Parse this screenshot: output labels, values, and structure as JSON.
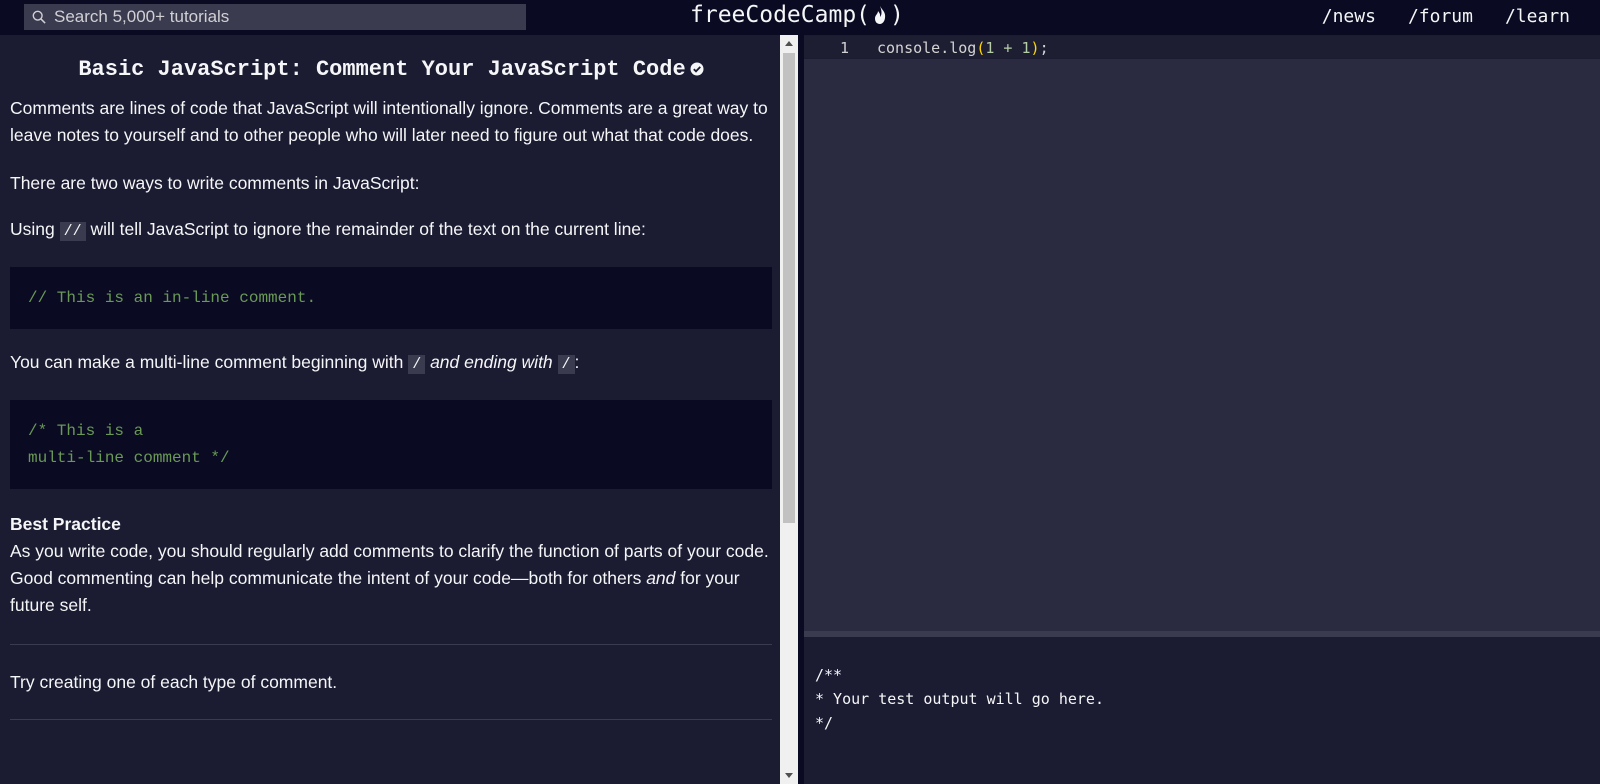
{
  "nav": {
    "search_placeholder": "Search 5,000+ tutorials",
    "logo_left": "freeCodeCamp(",
    "logo_right": ")",
    "links": [
      "/news",
      "/forum",
      "/learn"
    ]
  },
  "lesson": {
    "title": "Basic JavaScript: Comment Your JavaScript Code",
    "p1": "Comments are lines of code that JavaScript will intentionally ignore. Comments are a great way to leave notes to yourself and to other people who will later need to figure out what that code does.",
    "p2": "There are two ways to write comments in JavaScript:",
    "p3_before": "Using ",
    "p3_code": "//",
    "p3_after": " will tell JavaScript to ignore the remainder of the text on the current line:",
    "code1": "// This is an in-line comment.",
    "p4_before": "You can make a multi-line comment beginning with ",
    "p4_code1": "/",
    "p4_italic": " and ending with ",
    "p4_code2": " /",
    "p4_after": ":",
    "code2": "/* This is a\nmulti-line comment */",
    "bp_title": "Best Practice",
    "bp_before": "As you write code, you should regularly add comments to clarify the function of parts of your code. Good commenting can help communicate the intent of your code—both for others ",
    "bp_italic": "and",
    "bp_after": " for your future self.",
    "task": "Try creating one of each type of comment."
  },
  "editor": {
    "line_number": "1",
    "code_ident": "console.log",
    "code_open": "(",
    "code_expr": "1 + 1",
    "code_close": ")",
    "code_semicolon": ";"
  },
  "output": {
    "text": "/**\n* Your test output will go here.\n*/"
  },
  "colors": {
    "nav_bg": "#0a0a23",
    "pane_bg": "#1b1b32",
    "editor_bg": "#2a2a40",
    "comment_green": "#6a9955",
    "bracket_yellow": "#ffd700"
  }
}
